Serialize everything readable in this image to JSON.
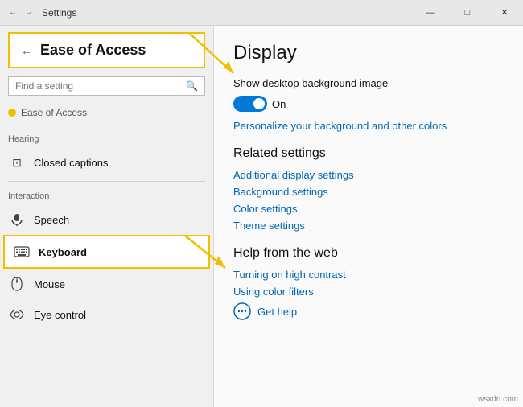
{
  "titlebar": {
    "title": "Settings",
    "nav_back": "←",
    "nav_forward": "→",
    "minimize": "—",
    "maximize": "□",
    "close": "✕"
  },
  "sidebar": {
    "header": "Ease of Access",
    "search_placeholder": "Find a setting",
    "breadcrumb": "Ease of Access",
    "sections": [
      {
        "label": "Hearing",
        "items": [
          {
            "id": "closed-captions",
            "label": "Closed captions",
            "icon": "⊡"
          }
        ]
      },
      {
        "label": "Interaction",
        "items": [
          {
            "id": "speech",
            "label": "Speech",
            "icon": "🎤"
          },
          {
            "id": "keyboard",
            "label": "Keyboard",
            "icon": "⌨"
          },
          {
            "id": "mouse",
            "label": "Mouse",
            "icon": "🖱"
          },
          {
            "id": "eye-control",
            "label": "Eye control",
            "icon": "👁"
          }
        ]
      }
    ]
  },
  "content": {
    "title": "Display",
    "bg_image_label": "Show desktop background image",
    "toggle_state": "On",
    "personalize_link": "Personalize your background and other colors",
    "related_settings_heading": "Related settings",
    "related_links": [
      "Additional display settings",
      "Background settings",
      "Color settings",
      "Theme settings"
    ],
    "help_heading": "Help from the web",
    "help_links": [
      "Turning on high contrast",
      "Using color filters"
    ],
    "get_help": "Get help"
  },
  "watermark": "wsxdn.com"
}
